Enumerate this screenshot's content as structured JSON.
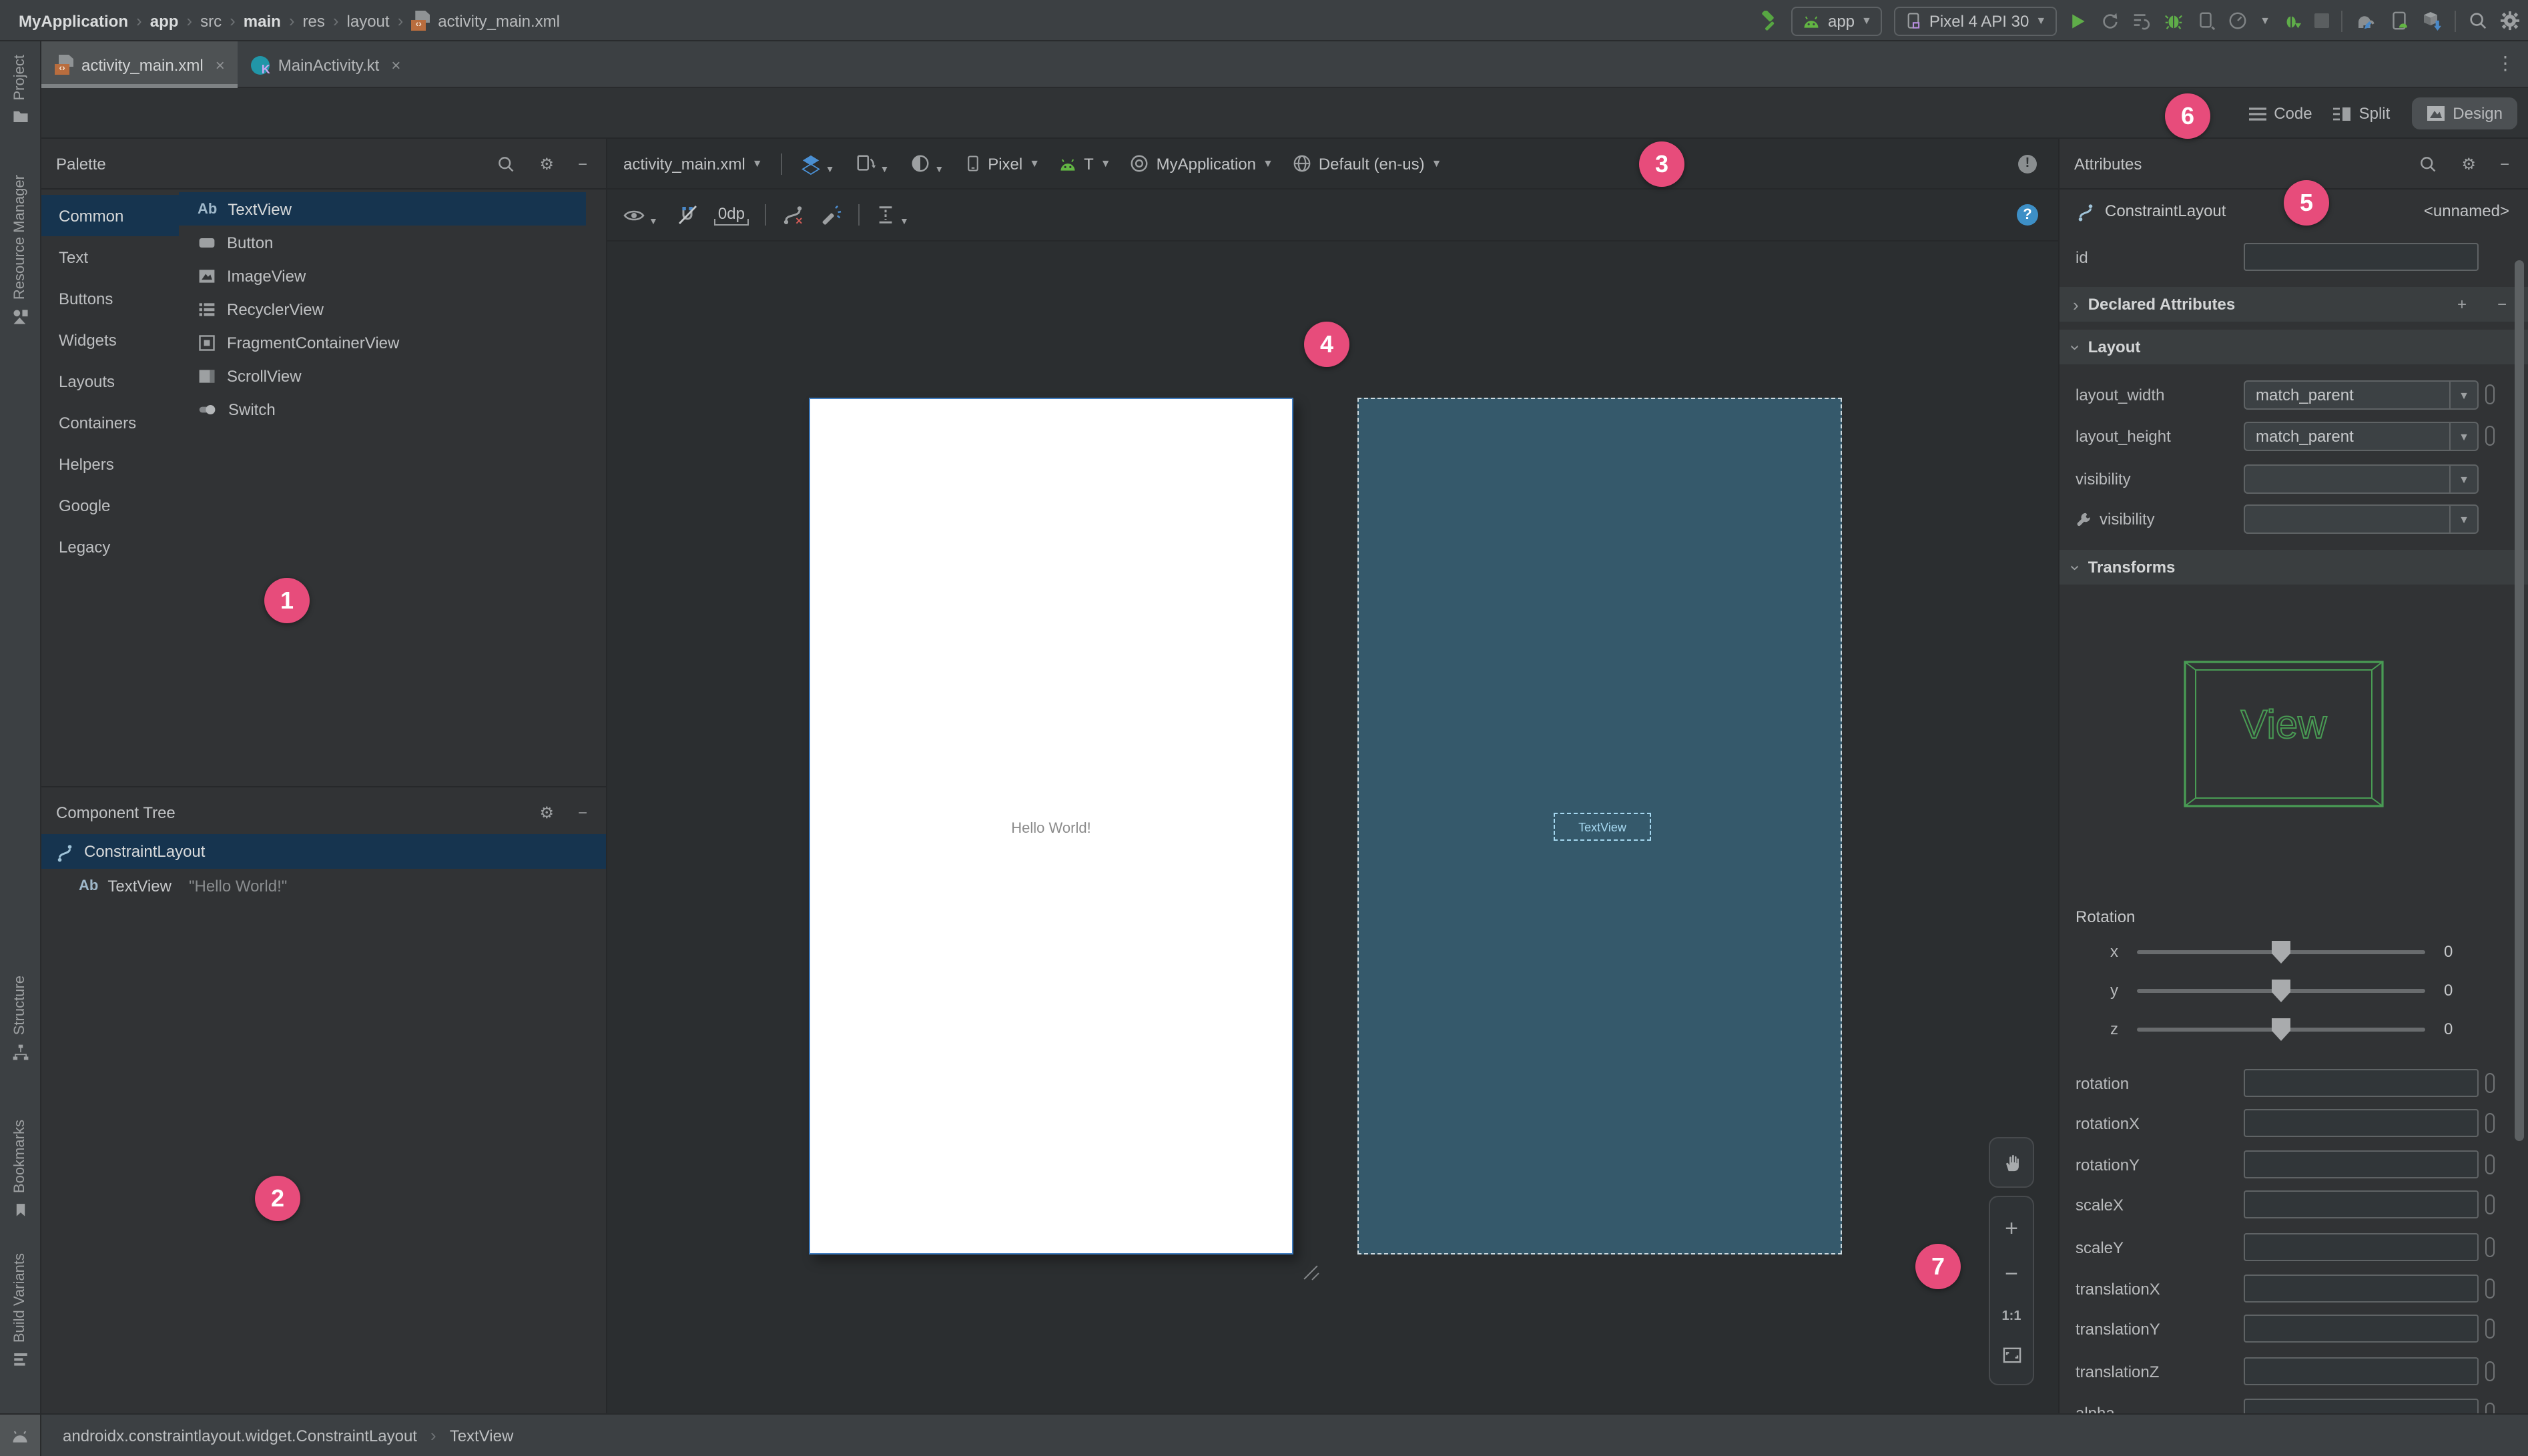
{
  "colors": {
    "accent_pink": "#e74c7b",
    "selection_blue": "#16344f",
    "blueprint_teal": "#35596b",
    "wireframe_green": "#499c54",
    "help_blue": "#3d8fc6"
  },
  "topbar": {
    "breadcrumbs": [
      {
        "label": "MyApplication"
      },
      {
        "label": "app"
      },
      {
        "label": "src"
      },
      {
        "label": "main"
      },
      {
        "label": "res"
      },
      {
        "label": "layout"
      },
      {
        "label": "activity_main.xml"
      }
    ],
    "run_config": "app",
    "device": "Pixel 4 API 30"
  },
  "tabs": [
    {
      "label": "activity_main.xml",
      "close": "×"
    },
    {
      "label": "MainActivity.kt",
      "close": "×"
    }
  ],
  "view_modes": {
    "code": "Code",
    "split": "Split",
    "design": "Design",
    "active": "Design"
  },
  "tool_strip": {
    "top": [
      "Project",
      "Resource Manager"
    ],
    "bottom": [
      "Structure",
      "Bookmarks",
      "Build Variants"
    ]
  },
  "palette": {
    "title": "Palette",
    "categories": [
      "Common",
      "Text",
      "Buttons",
      "Widgets",
      "Layouts",
      "Containers",
      "Helpers",
      "Google",
      "Legacy"
    ],
    "selected_category": "Common",
    "items": [
      {
        "abbr": "Ab",
        "label": "TextView"
      },
      {
        "label": "Button"
      },
      {
        "label": "ImageView"
      },
      {
        "label": "RecyclerView"
      },
      {
        "label": "FragmentContainerView"
      },
      {
        "label": "ScrollView"
      },
      {
        "label": "Switch"
      }
    ],
    "selected_item": "TextView"
  },
  "component_tree": {
    "title": "Component Tree",
    "rows": [
      {
        "label": "ConstraintLayout"
      },
      {
        "abbr": "Ab",
        "label": "TextView",
        "value": "\"Hello World!\""
      }
    ]
  },
  "design_toolbar": {
    "file": "activity_main.xml",
    "device": "Pixel",
    "api_level": "T",
    "theme": "MyApplication",
    "locale": "Default (en-us)",
    "default_margin": "0dp"
  },
  "canvas": {
    "design_preview_text": "Hello World!",
    "blueprint_component_label": "TextView",
    "zoom_controls": {
      "zoom_in": "+",
      "zoom_out": "−",
      "zoom_100": "1:1"
    }
  },
  "attributes": {
    "title": "Attributes",
    "component": "ConstraintLayout",
    "component_id": "<unnamed>",
    "id_label": "id",
    "id_value": "",
    "declared_section": "Declared Attributes",
    "layout_section": "Layout",
    "transforms_section": "Transforms",
    "layout_rows": [
      {
        "label": "layout_width",
        "value": "match_parent"
      },
      {
        "label": "layout_height",
        "value": "match_parent"
      },
      {
        "label": "visibility",
        "value": ""
      },
      {
        "label": "visibility",
        "value": ""
      }
    ],
    "view_preview_label": "View",
    "rotation": {
      "label": "Rotation",
      "sliders": [
        {
          "axis": "x",
          "value": "0"
        },
        {
          "axis": "y",
          "value": "0"
        },
        {
          "axis": "z",
          "value": "0"
        }
      ]
    },
    "transform_fields": [
      "rotation",
      "rotationX",
      "rotationY",
      "scaleX",
      "scaleY",
      "translationX",
      "translationY",
      "translationZ",
      "alpha"
    ]
  },
  "status_bar": {
    "segments": [
      "androidx.constraintlayout.widget.ConstraintLayout",
      "TextView"
    ],
    "separator": "›"
  },
  "icons": {
    "error": "!",
    "help": "?",
    "xml_tag": "‹›",
    "kotlin_letter": "K"
  },
  "callouts": [
    "1",
    "2",
    "3",
    "4",
    "5",
    "6",
    "7"
  ]
}
